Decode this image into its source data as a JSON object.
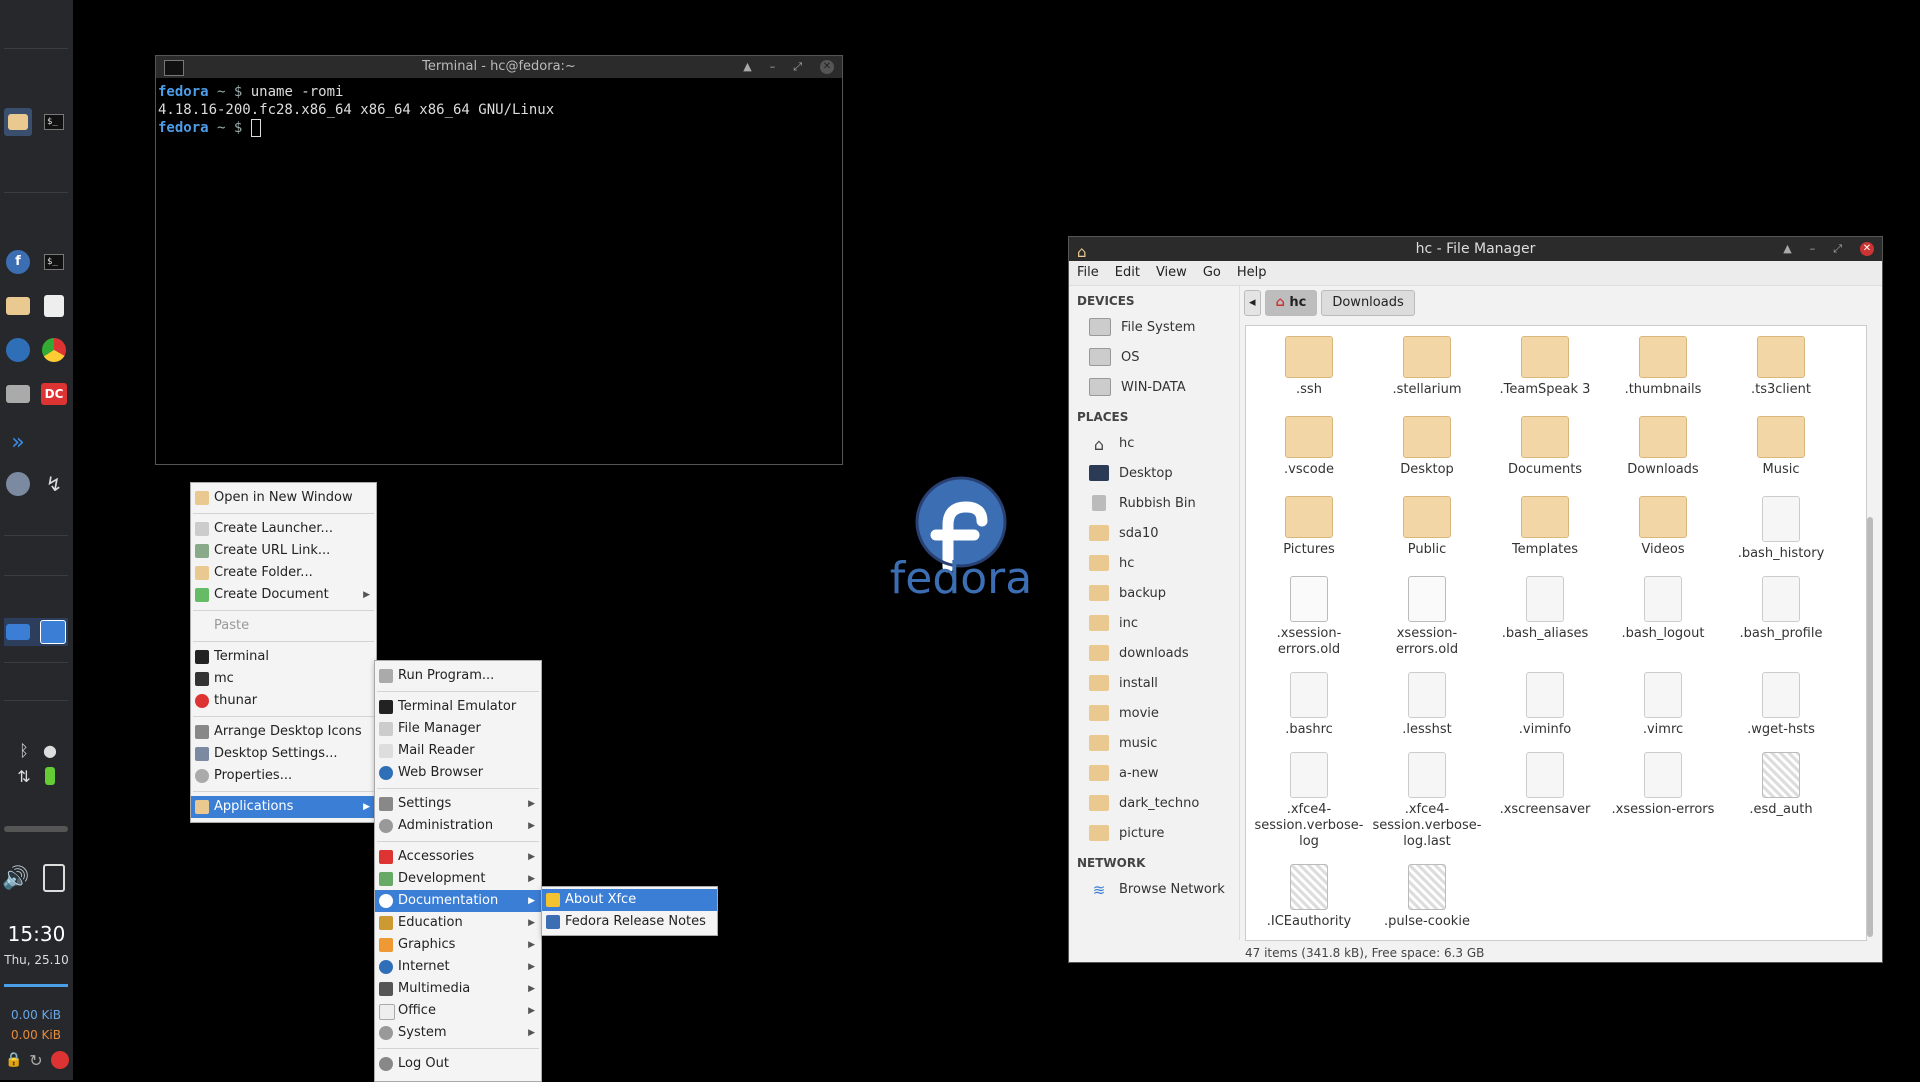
{
  "panel": {
    "clock": "15:30",
    "date": "Thu, 25.10",
    "net_down": "0.00 KiB",
    "net_up": "0.00 KiB",
    "colors": {
      "bg": "#26282c",
      "accent": "#3b7ed6"
    }
  },
  "terminal": {
    "title": "Terminal - hc@fedora:~",
    "lines": [
      {
        "user": "fedora",
        "sym": " ~ $ ",
        "cmd": "uname -romi"
      },
      {
        "output": "4.18.16-200.fc28.x86_64 x86_64 x86_64 GNU/Linux"
      },
      {
        "user": "fedora",
        "sym": " ~ $ ",
        "cmd": ""
      }
    ]
  },
  "desktop": {
    "logo_text": "fedora"
  },
  "context_menu": {
    "items": [
      {
        "label": "Open in New Window"
      },
      {
        "label": "Create Launcher..."
      },
      {
        "label": "Create URL Link..."
      },
      {
        "label": "Create Folder..."
      },
      {
        "label": "Create Document"
      },
      {
        "label": "Paste"
      },
      {
        "label": "Terminal"
      },
      {
        "label": "mc"
      },
      {
        "label": "thunar"
      },
      {
        "label": "Arrange Desktop Icons"
      },
      {
        "label": "Desktop Settings..."
      },
      {
        "label": "Properties..."
      },
      {
        "label": "Applications"
      }
    ]
  },
  "apps_menu": {
    "items": [
      {
        "label": "Run Program..."
      },
      {
        "label": "Terminal Emulator"
      },
      {
        "label": "File Manager"
      },
      {
        "label": "Mail Reader"
      },
      {
        "label": "Web Browser"
      },
      {
        "label": "Settings"
      },
      {
        "label": "Administration"
      },
      {
        "label": "Accessories"
      },
      {
        "label": "Development"
      },
      {
        "label": "Documentation"
      },
      {
        "label": "Education"
      },
      {
        "label": "Graphics"
      },
      {
        "label": "Internet"
      },
      {
        "label": "Multimedia"
      },
      {
        "label": "Office"
      },
      {
        "label": "System"
      },
      {
        "label": "Log Out"
      }
    ]
  },
  "doc_menu": {
    "items": [
      {
        "label": "About Xfce"
      },
      {
        "label": "Fedora Release Notes"
      }
    ]
  },
  "file_manager": {
    "title": "hc - File Manager",
    "menubar": [
      "File",
      "Edit",
      "View",
      "Go",
      "Help"
    ],
    "sidebar": {
      "devices_header": "DEVICES",
      "devices": [
        "File System",
        "OS",
        "WIN-DATA"
      ],
      "places_header": "PLACES",
      "places": [
        "hc",
        "Desktop",
        "Rubbish Bin",
        "sda10",
        "hc",
        "backup",
        "inc",
        "downloads",
        "install",
        "movie",
        "music",
        "a-new",
        "dark_techno",
        "picture"
      ],
      "network_header": "NETWORK",
      "network": [
        "Browse Network"
      ]
    },
    "path": [
      "hc",
      "Downloads"
    ],
    "items": [
      {
        "name": ".ssh",
        "type": "folder"
      },
      {
        "name": ".stellarium",
        "type": "folder"
      },
      {
        "name": ".TeamSpeak 3",
        "type": "folder"
      },
      {
        "name": ".thumbnails",
        "type": "folder"
      },
      {
        "name": ".ts3client",
        "type": "folder"
      },
      {
        "name": ".vscode",
        "type": "folder"
      },
      {
        "name": "Desktop",
        "type": "folder"
      },
      {
        "name": "Documents",
        "type": "folder"
      },
      {
        "name": "Downloads",
        "type": "folder"
      },
      {
        "name": "Music",
        "type": "folder"
      },
      {
        "name": "Pictures",
        "type": "folder"
      },
      {
        "name": "Public",
        "type": "folder"
      },
      {
        "name": "Templates",
        "type": "folder"
      },
      {
        "name": "Videos",
        "type": "folder"
      },
      {
        "name": ".bash_history",
        "type": "doc"
      },
      {
        "name": ".xsession-errors.old",
        "type": "blank"
      },
      {
        "name": "xsession-errors.old",
        "type": "blank"
      },
      {
        "name": ".bash_aliases",
        "type": "doc"
      },
      {
        "name": ".bash_logout",
        "type": "doc"
      },
      {
        "name": ".bash_profile",
        "type": "doc"
      },
      {
        "name": ".bashrc",
        "type": "doc"
      },
      {
        "name": ".lesshst",
        "type": "doc"
      },
      {
        "name": ".viminfo",
        "type": "doc"
      },
      {
        "name": ".vimrc",
        "type": "doc"
      },
      {
        "name": ".wget-hsts",
        "type": "doc"
      },
      {
        "name": ".xfce4-session.verbose-log",
        "type": "doc"
      },
      {
        "name": ".xfce4-session.verbose-log.last",
        "type": "doc"
      },
      {
        "name": ".xscreensaver",
        "type": "doc"
      },
      {
        "name": ".xsession-errors",
        "type": "doc"
      },
      {
        "name": ".esd_auth",
        "type": "check"
      },
      {
        "name": ".ICEauthority",
        "type": "check"
      },
      {
        "name": ".pulse-cookie",
        "type": "check"
      }
    ],
    "status": "47 items (341.8 kB), Free space: 6.3 GB"
  }
}
